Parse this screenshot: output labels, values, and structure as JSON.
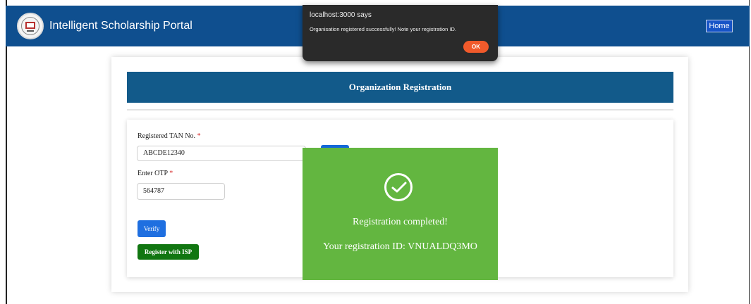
{
  "header": {
    "app_title": "Intelligent Scholarship Portal",
    "home_label": "Home"
  },
  "alert": {
    "title": "localhost:3000 says",
    "message": "Organisation registered successfully! Note your registration ID.",
    "ok_label": "OK"
  },
  "form": {
    "heading": "Organization Registration",
    "tan_label": "Registered TAN No.",
    "tan_value": "ABCDE12340",
    "otp_label": "Enter OTP",
    "otp_value": "564787",
    "required_mark": "*",
    "verify_label": "Verify",
    "register_label": "Register with ISP"
  },
  "modal": {
    "title": "Registration completed!",
    "id_text": "Your registration ID: VNUALDQ3MO"
  },
  "colors": {
    "header": "#0f4f8f",
    "banner": "#125a8a",
    "modal": "#63b640",
    "register_button": "#117611",
    "verify_button": "#1f6fe0",
    "alert_ok": "#f15a2b"
  }
}
